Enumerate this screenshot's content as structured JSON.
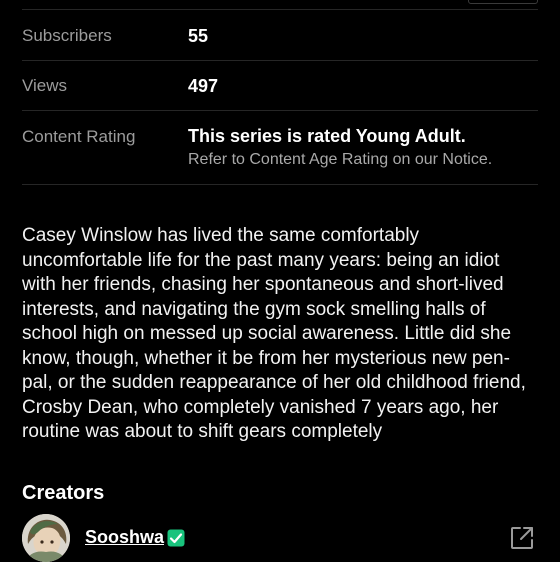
{
  "stats": {
    "subscribers": {
      "label": "Subscribers",
      "value": "55"
    },
    "views": {
      "label": "Views",
      "value": "497"
    },
    "content_rating": {
      "label": "Content Rating",
      "value": "This series is rated Young Adult.",
      "note": "Refer to Content Age Rating on our Notice."
    }
  },
  "description": "Casey Winslow has lived the same comfortably uncomfortable life for the past many years: being an idiot with her friends, chasing her spontaneous and short-lived interests, and navigating the gym sock smelling halls of school high on messed up social awareness. Little did she know, though, whether it be from her mysterious new pen-pal, or the sudden reappearance of her old childhood friend, Crosby Dean, who completely vanished 7 years ago, her routine was about to shift gears completely",
  "creators": {
    "heading": "Creators",
    "items": [
      {
        "name": "Sooshwa",
        "verified": true,
        "avatar_icon": "avatar-portrait",
        "link_icon": "external-link-icon"
      }
    ]
  },
  "colors": {
    "background": "#000000",
    "label": "#9c9c9c",
    "divider": "#262626",
    "verified": "#19c37d"
  }
}
